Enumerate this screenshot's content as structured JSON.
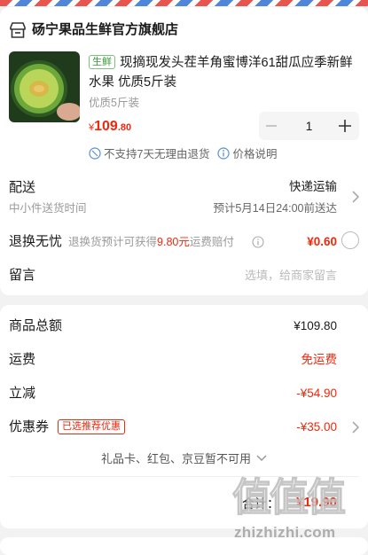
{
  "store": {
    "name": "砀宁果品生鲜官方旗舰店",
    "icon": "store-icon"
  },
  "product": {
    "tag": "生鲜",
    "title": "现摘现发头茬羊角蜜博洋61甜瓜应季新鲜水果 优质5斤装",
    "spec": "优质5斤装",
    "price_symbol": "¥",
    "price_int": "109",
    "price_dec": ".80",
    "quantity": "1",
    "image": "melon-slice-photo"
  },
  "notice": {
    "no_return": "不支持7天无理由退货",
    "price_info": "价格说明"
  },
  "delivery": {
    "label": "配送",
    "method": "快递运输",
    "time_label": "中小件送货时间",
    "eta": "预计5月14日24:00前送达"
  },
  "return_insurance": {
    "label": "退换无忧",
    "desc_prefix": "退换货预计可获得",
    "desc_amount": "9.80元",
    "desc_suffix": "运费赔付",
    "price": "¥0.60",
    "selected": false
  },
  "message": {
    "label": "留言",
    "placeholder": "选填，给商家留言"
  },
  "summary": {
    "goods_total_label": "商品总额",
    "goods_total": "¥109.80",
    "shipping_label": "运费",
    "shipping": "免运费",
    "discount_label": "立减",
    "discount": "-¥54.90",
    "coupon_label": "优惠券",
    "coupon_badge": "已选推荐优惠",
    "coupon": "-¥35.00",
    "gift_note": "礼品卡、红包、京豆暂不可用"
  },
  "total": {
    "label": "合计：",
    "value": "¥19.90"
  },
  "watermark": {
    "logo_text": "值值值",
    "site": "zhizhizhi.com"
  },
  "colors": {
    "accent_red": "#f2270c",
    "tag_green": "#3c9a3c",
    "page_bg": "#f2f2f2"
  }
}
